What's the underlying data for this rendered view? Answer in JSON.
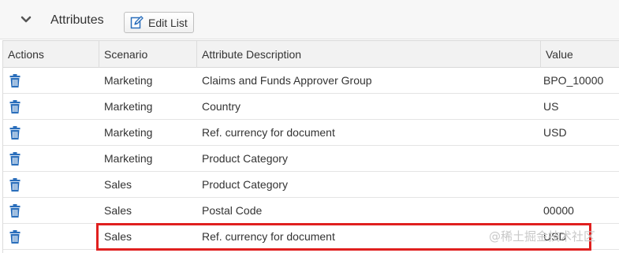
{
  "header": {
    "title": "Attributes",
    "edit_button_label": "Edit List"
  },
  "table": {
    "columns": [
      "Actions",
      "Scenario",
      "Attribute Description",
      "Value"
    ],
    "rows": [
      {
        "scenario": "Marketing",
        "description": "Claims and Funds Approver Group",
        "value": "BPO_10000"
      },
      {
        "scenario": "Marketing",
        "description": "Country",
        "value": "US"
      },
      {
        "scenario": "Marketing",
        "description": "Ref. currency for document",
        "value": "USD"
      },
      {
        "scenario": "Marketing",
        "description": "Product Category",
        "value": ""
      },
      {
        "scenario": "Sales",
        "description": "Product Category",
        "value": ""
      },
      {
        "scenario": "Sales",
        "description": "Postal Code",
        "value": "00000"
      },
      {
        "scenario": "Sales",
        "description": "Ref. currency for document",
        "value": "USD"
      }
    ]
  },
  "watermark": "@稀土掘金技术社区",
  "colors": {
    "icon_blue": "#2a6ebb",
    "highlight_red": "#e0201f",
    "header_bg": "#f7f7f7"
  },
  "icons": {
    "collapse": "chevron-down-icon",
    "edit": "edit-pencil-icon",
    "delete": "trash-icon"
  }
}
